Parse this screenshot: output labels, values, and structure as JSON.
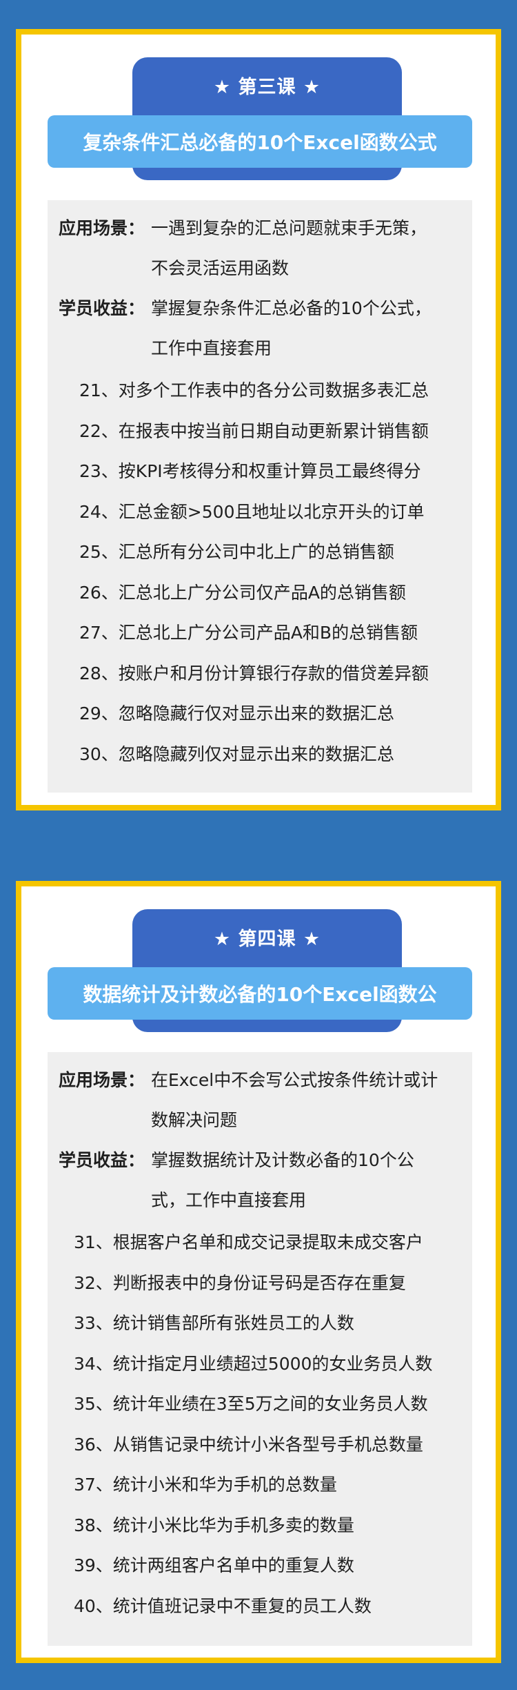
{
  "lessons": [
    {
      "label": "★ 第三课 ★",
      "title": "复杂条件汇总必备的10个Excel函数公式",
      "scene_label": "应用场景：",
      "scene_line1": "一遇到复杂的汇总问题就束手无策，",
      "scene_line2": "不会灵活运用函数",
      "gain_label": "学员收益：",
      "gain_line1": "掌握复杂条件汇总必备的10个公式，",
      "gain_line2": "工作中直接套用",
      "items": [
        "21、对多个工作表中的各分公司数据多表汇总",
        "22、在报表中按当前日期自动更新累计销售额",
        "23、按KPI考核得分和权重计算员工最终得分",
        "24、汇总金额>500且地址以北京开头的订单",
        "25、汇总所有分公司中北上广的总销售额",
        "26、汇总北上广分公司仅产品A的总销售额",
        "27、汇总北上广分公司产品A和B的总销售额",
        "28、按账户和月份计算银行存款的借贷差异额",
        "29、忽略隐藏行仅对显示出来的数据汇总",
        "30、忽略隐藏列仅对显示出来的数据汇总"
      ]
    },
    {
      "label": "★ 第四课 ★",
      "title": "数据统计及计数必备的10个Excel函数公",
      "scene_label": "应用场景：",
      "scene_line1": "在Excel中不会写公式按条件统计或计",
      "scene_line2": "数解决问题",
      "gain_label": "学员收益：",
      "gain_line1": "掌握数据统计及计数必备的10个公",
      "gain_line2": "式，工作中直接套用",
      "items": [
        "31、根据客户名单和成交记录提取未成交客户",
        "32、判断报表中的身份证号码是否存在重复",
        "33、统计销售部所有张姓员工的人数",
        "34、统计指定月业绩超过5000的女业务员人数",
        "35、统计年业绩在3至5万之间的女业务员人数",
        "36、从销售记录中统计小米各型号手机总数量",
        "37、统计小米和华为手机的总数量",
        "38、统计小米比华为手机多卖的数量",
        "39、统计两组客户名单中的重复人数",
        "40、统计值班记录中不重复的员工人数"
      ]
    }
  ]
}
